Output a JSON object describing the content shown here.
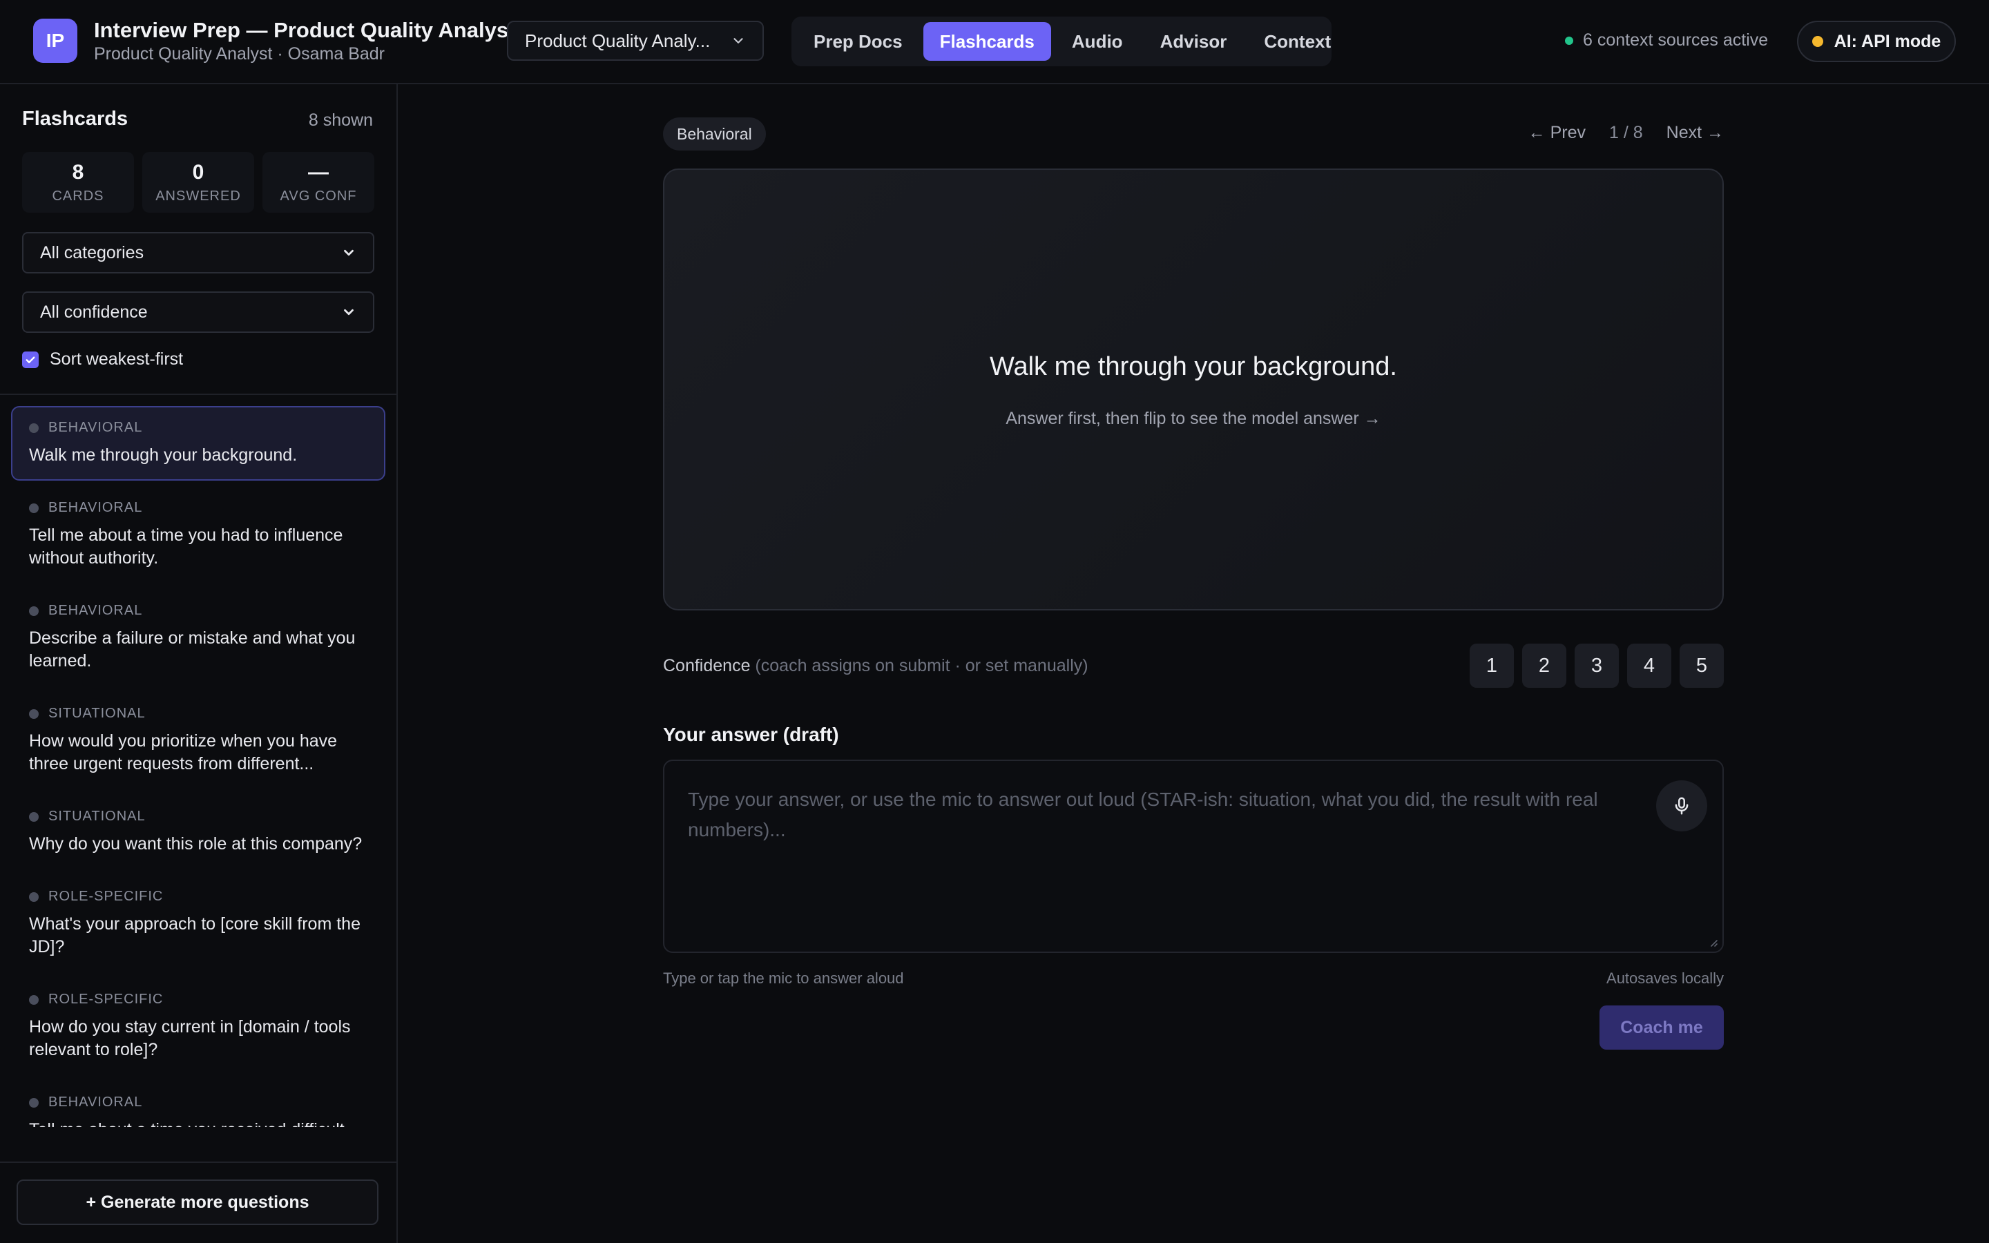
{
  "header": {
    "logo_text": "IP",
    "title": "Interview Prep — Product Quality Analyst",
    "subtitle": "Product Quality Analyst · Osama Badr",
    "profile_select": "Product Quality Analy...",
    "tabs": [
      {
        "label": "Prep Docs",
        "active": false
      },
      {
        "label": "Flashcards",
        "active": true
      },
      {
        "label": "Audio",
        "active": false
      },
      {
        "label": "Advisor",
        "active": false
      },
      {
        "label": "Context",
        "active": false
      }
    ],
    "context_status": "6 context sources active",
    "context_status_color": "#22c58b",
    "ai_mode": "AI: API mode",
    "ai_mode_color": "#f5b82e"
  },
  "sidebar": {
    "title": "Flashcards",
    "shown_count": "8 shown",
    "stats": [
      {
        "value": "8",
        "label": "CARDS"
      },
      {
        "value": "0",
        "label": "ANSWERED"
      },
      {
        "value": "—",
        "label": "AVG CONF"
      }
    ],
    "category_filter": "All categories",
    "confidence_filter": "All confidence",
    "sort_label": "Sort weakest-first",
    "sort_checked": true,
    "questions": [
      {
        "category": "Behavioral",
        "text": "Walk me through your background.",
        "active": true
      },
      {
        "category": "Behavioral",
        "text": "Tell me about a time you had to influence without authority.",
        "active": false
      },
      {
        "category": "Behavioral",
        "text": "Describe a failure or mistake and what you learned.",
        "active": false
      },
      {
        "category": "Situational",
        "text": "How would you prioritize when you have three urgent requests from different...",
        "active": false
      },
      {
        "category": "Situational",
        "text": "Why do you want this role at this company?",
        "active": false
      },
      {
        "category": "Role-specific",
        "text": "What's your approach to [core skill from the JD]?",
        "active": false
      },
      {
        "category": "Role-specific",
        "text": "How do you stay current in [domain / tools relevant to role]?",
        "active": false
      },
      {
        "category": "Behavioral",
        "text": "Tell me about a time you received difficult",
        "active": false
      }
    ],
    "generate_label": "+ Generate more questions"
  },
  "main": {
    "category_badge": "Behavioral",
    "prev_label": "← Prev",
    "position": "1 / 8",
    "next_label": "Next →",
    "card_question": "Walk me through your background.",
    "card_hint": "Answer first, then flip to see the model answer →",
    "confidence_label": "Confidence",
    "confidence_note": " (coach assigns on submit · or set manually)",
    "confidence_options": [
      "1",
      "2",
      "3",
      "4",
      "5"
    ],
    "answer_title": "Your answer (draft)",
    "answer_placeholder": "Type your answer, or use the mic to answer out loud (STAR-ish: situation, what you did, the result with real numbers)...",
    "answer_value": "",
    "hint_left": "Type or tap the mic to answer aloud",
    "hint_right": "Autosaves locally",
    "coach_label": "Coach me",
    "accent_color": "#6c63f5"
  }
}
